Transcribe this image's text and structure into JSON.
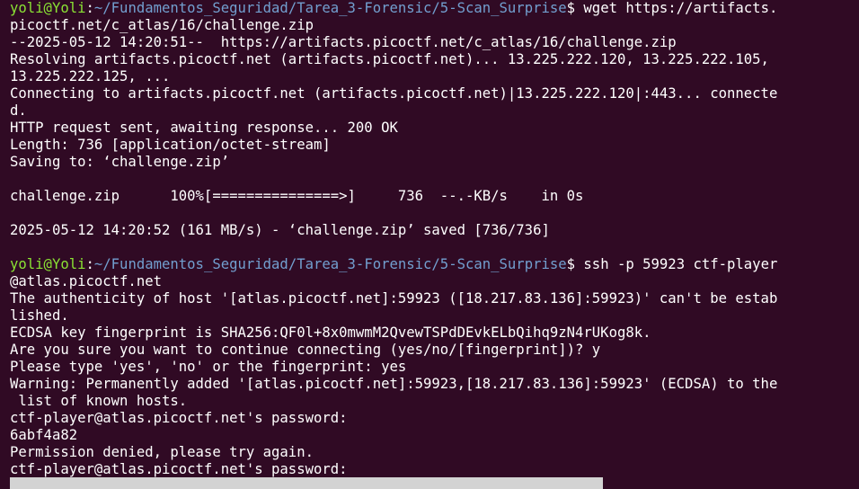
{
  "prompt": {
    "user": "yoli@Yoli",
    "path": "~/Fundamentos_Seguridad/Tarea_3-Forensic/5-Scan_Surprise",
    "symbol": "$"
  },
  "lines": [
    {
      "kind": "prompt",
      "command": " wget https://artifacts."
    },
    {
      "kind": "text",
      "text": "picoctf.net/c_atlas/16/challenge.zip"
    },
    {
      "kind": "text",
      "text": "--2025-05-12 14:20:51--  https://artifacts.picoctf.net/c_atlas/16/challenge.zip"
    },
    {
      "kind": "text",
      "text": "Resolving artifacts.picoctf.net (artifacts.picoctf.net)... 13.225.222.120, 13.225.222.105,"
    },
    {
      "kind": "text",
      "text": "13.225.222.125, ..."
    },
    {
      "kind": "text",
      "text": "Connecting to artifacts.picoctf.net (artifacts.picoctf.net)|13.225.222.120|:443... connecte"
    },
    {
      "kind": "text",
      "text": "d."
    },
    {
      "kind": "text",
      "text": "HTTP request sent, awaiting response... 200 OK"
    },
    {
      "kind": "text",
      "text": "Length: 736 [application/octet-stream]"
    },
    {
      "kind": "text",
      "text": "Saving to: ‘challenge.zip’"
    },
    {
      "kind": "text",
      "text": ""
    },
    {
      "kind": "text",
      "text": "challenge.zip      100%[===============>]     736  --.-KB/s    in 0s"
    },
    {
      "kind": "text",
      "text": ""
    },
    {
      "kind": "text",
      "text": "2025-05-12 14:20:52 (161 MB/s) - ‘challenge.zip’ saved [736/736]"
    },
    {
      "kind": "text",
      "text": ""
    },
    {
      "kind": "prompt",
      "command": " ssh -p 59923 ctf-player"
    },
    {
      "kind": "text",
      "text": "@atlas.picoctf.net"
    },
    {
      "kind": "text",
      "text": "The authenticity of host '[atlas.picoctf.net]:59923 ([18.217.83.136]:59923)' can't be estab"
    },
    {
      "kind": "text",
      "text": "lished."
    },
    {
      "kind": "text",
      "text": "ECDSA key fingerprint is SHA256:QF0l+8x0mwmM2QvewTSPdDEvkELbQihq9zN4rUKog8k."
    },
    {
      "kind": "text",
      "text": "Are you sure you want to continue connecting (yes/no/[fingerprint])? y"
    },
    {
      "kind": "text",
      "text": "Please type 'yes', 'no' or the fingerprint: yes"
    },
    {
      "kind": "text",
      "text": "Warning: Permanently added '[atlas.picoctf.net]:59923,[18.217.83.136]:59923' (ECDSA) to the"
    },
    {
      "kind": "text",
      "text": " list of known hosts."
    },
    {
      "kind": "text",
      "text": "ctf-player@atlas.picoctf.net's password:"
    },
    {
      "kind": "text",
      "text": "6abf4a82"
    },
    {
      "kind": "text",
      "text": "Permission denied, please try again."
    },
    {
      "kind": "text",
      "text": "ctf-player@atlas.picoctf.net's password:"
    }
  ]
}
